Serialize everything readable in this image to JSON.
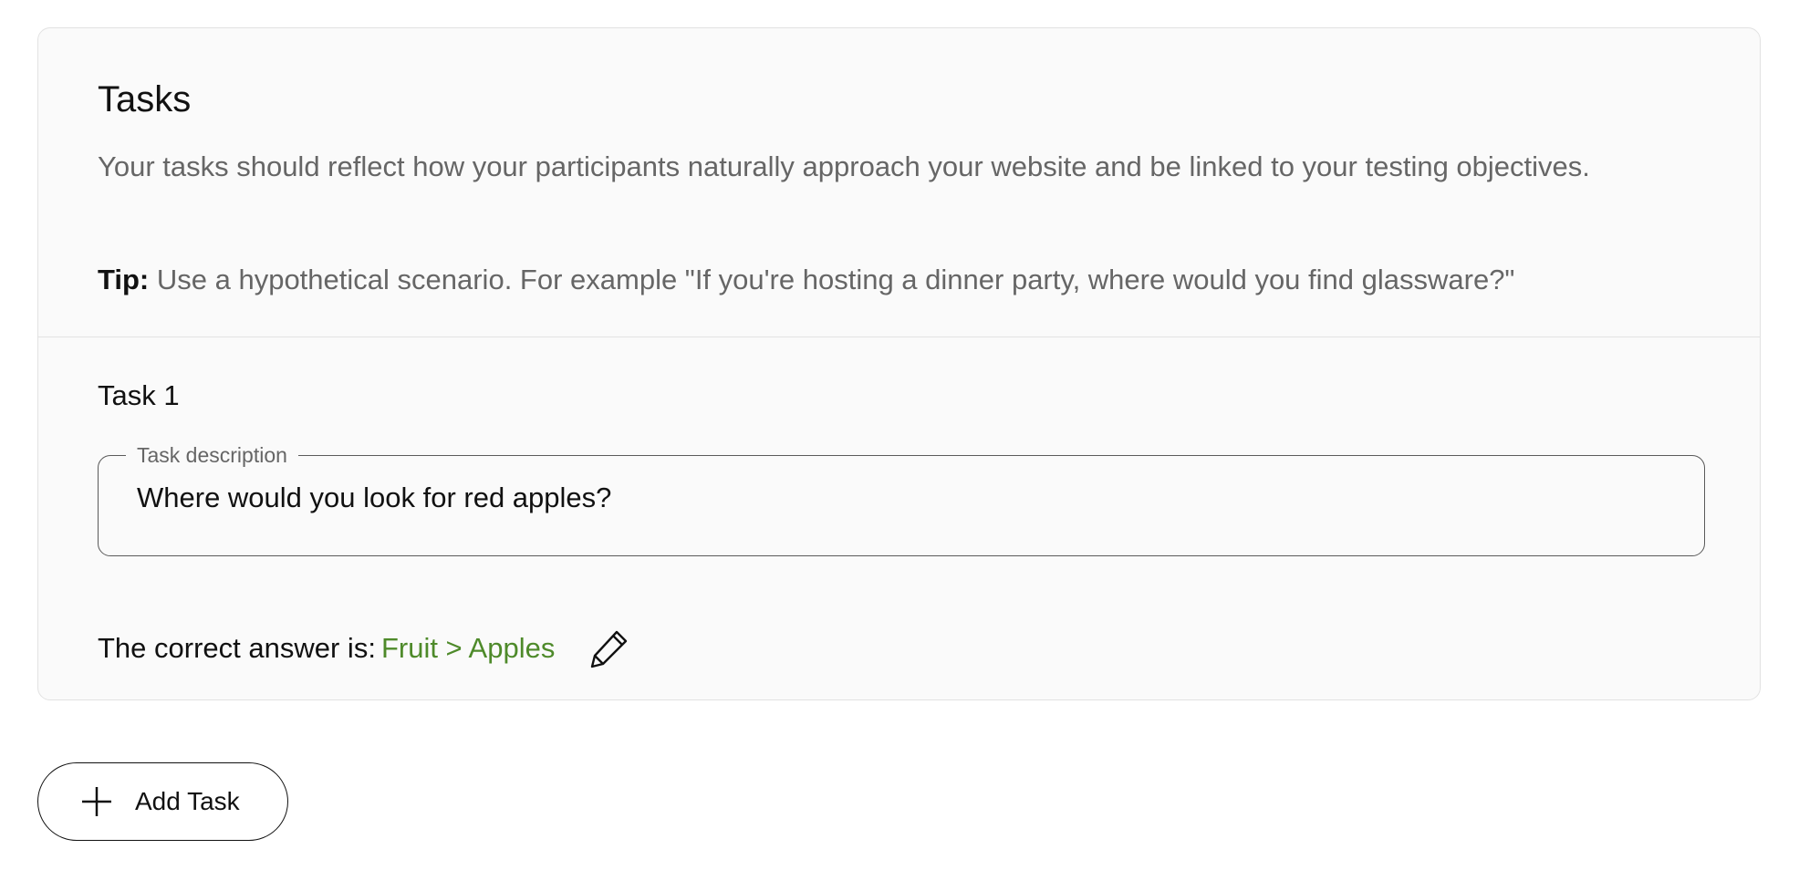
{
  "tasks_section": {
    "title": "Tasks",
    "description": "Your tasks should reflect how your participants naturally approach your website and be linked to your testing objectives.",
    "tip_label": "Tip:",
    "tip_text": " Use a hypothetical scenario. For example \"If you're hosting a dinner party, where would you find glassware?\""
  },
  "task": {
    "heading": "Task 1",
    "field_label": "Task description",
    "field_value": "Where would you look for red apples?",
    "answer_label": "The correct answer is:",
    "answer_value": "Fruit > Apples",
    "answer_color": "#4e8a2a",
    "edit_icon": "pencil-icon"
  },
  "add_task": {
    "label": "Add Task",
    "icon": "plus-icon"
  }
}
